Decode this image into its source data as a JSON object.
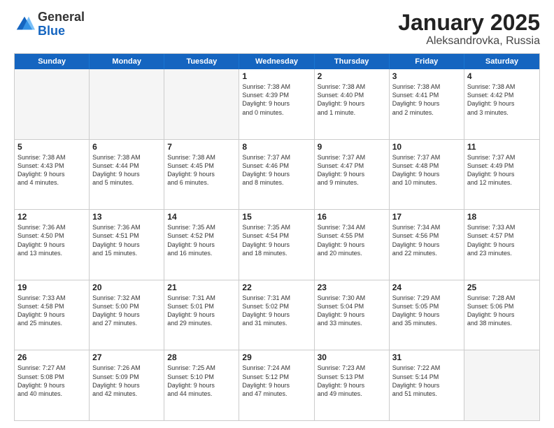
{
  "logo": {
    "general": "General",
    "blue": "Blue"
  },
  "title": "January 2025",
  "subtitle": "Aleksandrovka, Russia",
  "header_days": [
    "Sunday",
    "Monday",
    "Tuesday",
    "Wednesday",
    "Thursday",
    "Friday",
    "Saturday"
  ],
  "rows": [
    [
      {
        "day": "",
        "info": ""
      },
      {
        "day": "",
        "info": ""
      },
      {
        "day": "",
        "info": ""
      },
      {
        "day": "1",
        "info": "Sunrise: 7:38 AM\nSunset: 4:39 PM\nDaylight: 9 hours\nand 0 minutes."
      },
      {
        "day": "2",
        "info": "Sunrise: 7:38 AM\nSunset: 4:40 PM\nDaylight: 9 hours\nand 1 minute."
      },
      {
        "day": "3",
        "info": "Sunrise: 7:38 AM\nSunset: 4:41 PM\nDaylight: 9 hours\nand 2 minutes."
      },
      {
        "day": "4",
        "info": "Sunrise: 7:38 AM\nSunset: 4:42 PM\nDaylight: 9 hours\nand 3 minutes."
      }
    ],
    [
      {
        "day": "5",
        "info": "Sunrise: 7:38 AM\nSunset: 4:43 PM\nDaylight: 9 hours\nand 4 minutes."
      },
      {
        "day": "6",
        "info": "Sunrise: 7:38 AM\nSunset: 4:44 PM\nDaylight: 9 hours\nand 5 minutes."
      },
      {
        "day": "7",
        "info": "Sunrise: 7:38 AM\nSunset: 4:45 PM\nDaylight: 9 hours\nand 6 minutes."
      },
      {
        "day": "8",
        "info": "Sunrise: 7:37 AM\nSunset: 4:46 PM\nDaylight: 9 hours\nand 8 minutes."
      },
      {
        "day": "9",
        "info": "Sunrise: 7:37 AM\nSunset: 4:47 PM\nDaylight: 9 hours\nand 9 minutes."
      },
      {
        "day": "10",
        "info": "Sunrise: 7:37 AM\nSunset: 4:48 PM\nDaylight: 9 hours\nand 10 minutes."
      },
      {
        "day": "11",
        "info": "Sunrise: 7:37 AM\nSunset: 4:49 PM\nDaylight: 9 hours\nand 12 minutes."
      }
    ],
    [
      {
        "day": "12",
        "info": "Sunrise: 7:36 AM\nSunset: 4:50 PM\nDaylight: 9 hours\nand 13 minutes."
      },
      {
        "day": "13",
        "info": "Sunrise: 7:36 AM\nSunset: 4:51 PM\nDaylight: 9 hours\nand 15 minutes."
      },
      {
        "day": "14",
        "info": "Sunrise: 7:35 AM\nSunset: 4:52 PM\nDaylight: 9 hours\nand 16 minutes."
      },
      {
        "day": "15",
        "info": "Sunrise: 7:35 AM\nSunset: 4:54 PM\nDaylight: 9 hours\nand 18 minutes."
      },
      {
        "day": "16",
        "info": "Sunrise: 7:34 AM\nSunset: 4:55 PM\nDaylight: 9 hours\nand 20 minutes."
      },
      {
        "day": "17",
        "info": "Sunrise: 7:34 AM\nSunset: 4:56 PM\nDaylight: 9 hours\nand 22 minutes."
      },
      {
        "day": "18",
        "info": "Sunrise: 7:33 AM\nSunset: 4:57 PM\nDaylight: 9 hours\nand 23 minutes."
      }
    ],
    [
      {
        "day": "19",
        "info": "Sunrise: 7:33 AM\nSunset: 4:58 PM\nDaylight: 9 hours\nand 25 minutes."
      },
      {
        "day": "20",
        "info": "Sunrise: 7:32 AM\nSunset: 5:00 PM\nDaylight: 9 hours\nand 27 minutes."
      },
      {
        "day": "21",
        "info": "Sunrise: 7:31 AM\nSunset: 5:01 PM\nDaylight: 9 hours\nand 29 minutes."
      },
      {
        "day": "22",
        "info": "Sunrise: 7:31 AM\nSunset: 5:02 PM\nDaylight: 9 hours\nand 31 minutes."
      },
      {
        "day": "23",
        "info": "Sunrise: 7:30 AM\nSunset: 5:04 PM\nDaylight: 9 hours\nand 33 minutes."
      },
      {
        "day": "24",
        "info": "Sunrise: 7:29 AM\nSunset: 5:05 PM\nDaylight: 9 hours\nand 35 minutes."
      },
      {
        "day": "25",
        "info": "Sunrise: 7:28 AM\nSunset: 5:06 PM\nDaylight: 9 hours\nand 38 minutes."
      }
    ],
    [
      {
        "day": "26",
        "info": "Sunrise: 7:27 AM\nSunset: 5:08 PM\nDaylight: 9 hours\nand 40 minutes."
      },
      {
        "day": "27",
        "info": "Sunrise: 7:26 AM\nSunset: 5:09 PM\nDaylight: 9 hours\nand 42 minutes."
      },
      {
        "day": "28",
        "info": "Sunrise: 7:25 AM\nSunset: 5:10 PM\nDaylight: 9 hours\nand 44 minutes."
      },
      {
        "day": "29",
        "info": "Sunrise: 7:24 AM\nSunset: 5:12 PM\nDaylight: 9 hours\nand 47 minutes."
      },
      {
        "day": "30",
        "info": "Sunrise: 7:23 AM\nSunset: 5:13 PM\nDaylight: 9 hours\nand 49 minutes."
      },
      {
        "day": "31",
        "info": "Sunrise: 7:22 AM\nSunset: 5:14 PM\nDaylight: 9 hours\nand 51 minutes."
      },
      {
        "day": "",
        "info": ""
      }
    ]
  ]
}
